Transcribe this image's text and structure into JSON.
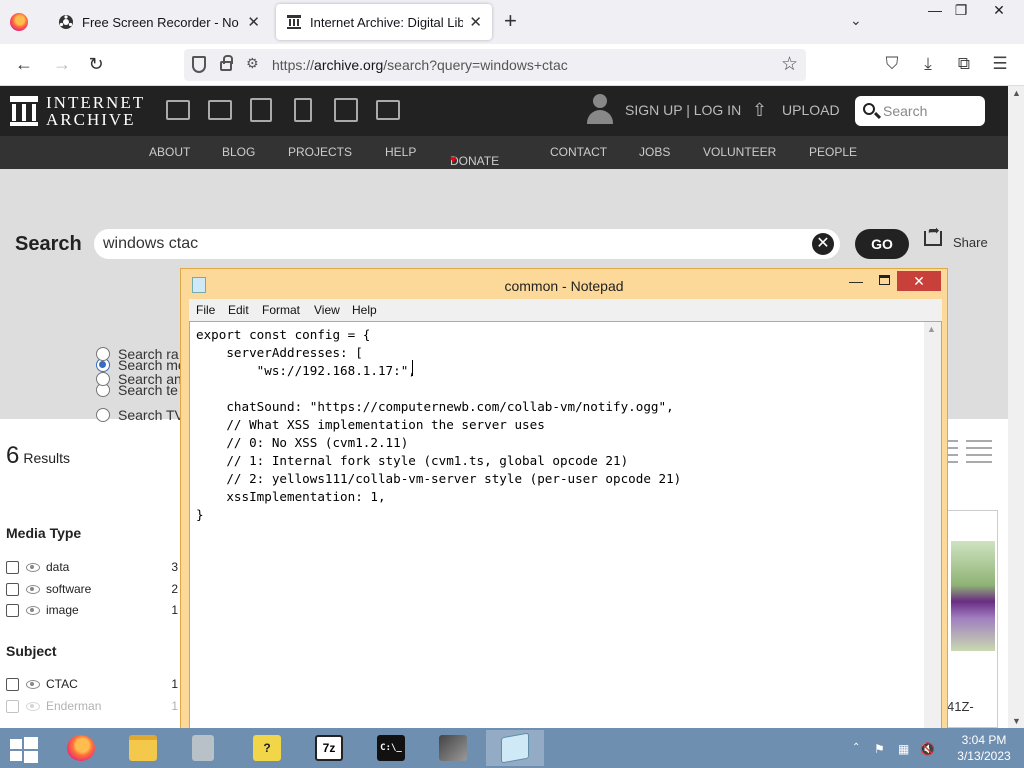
{
  "browser": {
    "tabs": [
      {
        "title": "Free Screen Recorder - No Acco",
        "close": "✕"
      },
      {
        "title": "Internet Archive: Digital Library",
        "close": "✕"
      }
    ],
    "new_tab": "+",
    "tab_list": "⌄",
    "window_controls": {
      "minimize": "—",
      "maximize": "❐",
      "close": "✕"
    },
    "back": "←",
    "forward": "→",
    "reload": "↻",
    "url_prefix": "https://",
    "url_host": "archive.org",
    "url_path": "/search?query=windows+ctac",
    "bookmark": "☆",
    "toolbar_icons": [
      "pocket-icon",
      "download-icon",
      "extensions-icon",
      "menu-icon"
    ],
    "toolbar_glyphs": {
      "pocket": "⛉",
      "download": "⤓",
      "extensions": "⧉",
      "menu": "☰"
    }
  },
  "archive": {
    "wordmark_line1": "INTERNET",
    "wordmark_line2": "ARCHIVE",
    "signup": "SIGN UP | LOG IN",
    "upload": "UPLOAD",
    "search_placeholder": "Search",
    "nav": [
      "ABOUT",
      "BLOG",
      "PROJECTS",
      "HELP",
      "DONATE",
      "CONTACT",
      "JOBS",
      "VOLUNTEER",
      "PEOPLE"
    ],
    "donate_heart": "♥",
    "search_label": "Search",
    "search_value": "windows ctac",
    "clear": "✕",
    "go": "GO",
    "share": "Share",
    "radio_options": [
      "Search me",
      "Search te",
      "Search TV",
      "Search ra",
      "Search an"
    ],
    "results_count": "6",
    "results_label": "Results",
    "facets": [
      {
        "title": "Media Type",
        "items": [
          {
            "label": "data",
            "count": "3"
          },
          {
            "label": "software",
            "count": "2"
          },
          {
            "label": "image",
            "count": "1"
          }
        ]
      },
      {
        "title": "Subject",
        "items": [
          {
            "label": "CTAC",
            "count": "1"
          },
          {
            "label": "Enderman",
            "count": "1"
          }
        ]
      }
    ],
    "card_id_fragment": "41Z-"
  },
  "notepad": {
    "title": "common - Notepad",
    "menu": [
      "File",
      "Edit",
      "Format",
      "View",
      "Help"
    ],
    "minimize": "—",
    "close": "✕",
    "content": "export const config = {\n    serverAddresses: [\n        \"ws://192.168.1.17:\",\n\n    chatSound: \"https://computernewb.com/collab-vm/notify.ogg\",\n    // What XSS implementation the server uses\n    // 0: No XSS (cvm1.2.11)\n    // 1: Internal fork style (cvm1.ts, global opcode 21)\n    // 2: yellows111/collab-vm-server style (per-user opcode 21)\n    xssImplementation: 1,\n}"
  },
  "taskbar": {
    "apps": [
      "firefox-icon",
      "file-explorer-icon",
      "archive-tool-icon",
      "help-icon",
      "7zip-icon",
      "cmd-icon",
      "tool-icon",
      "notepad-icon"
    ],
    "sevenzip_label": "7z",
    "cmd_label": "C:\\_",
    "help_label": "?",
    "tray_glyphs": {
      "show_hidden": "⌃",
      "flag": "⚑",
      "network": "▦",
      "volume": "🔇"
    },
    "time": "3:04 PM",
    "date": "3/13/2023"
  },
  "colors": {
    "ia_header": "#222222",
    "notepad_frame": "#fdd999",
    "taskbar": "#6f8fb0",
    "close_red": "#c7413a"
  }
}
